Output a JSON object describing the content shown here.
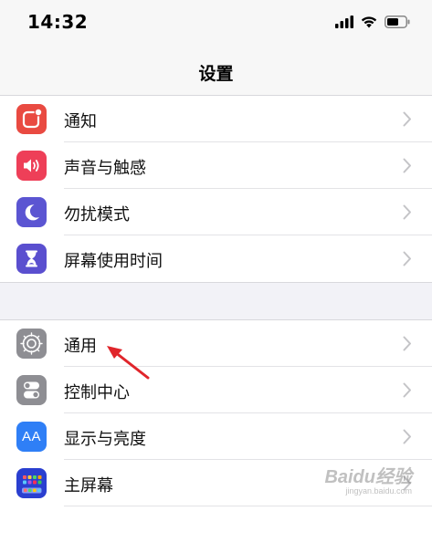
{
  "status_bar": {
    "time": "14:32",
    "icons": [
      "signal-icon",
      "wifi-icon",
      "battery-icon"
    ]
  },
  "nav": {
    "title": "设置"
  },
  "groups": [
    {
      "items": [
        {
          "label": "通知",
          "icon": "notifications-icon",
          "icon_color": "#e94a41"
        },
        {
          "label": "声音与触感",
          "icon": "sound-icon",
          "icon_color": "#ee3f58"
        },
        {
          "label": "勿扰模式",
          "icon": "moon-icon",
          "icon_color": "#5b55d2"
        },
        {
          "label": "屏幕使用时间",
          "icon": "hourglass-icon",
          "icon_color": "#5a4fcf"
        }
      ]
    },
    {
      "items": [
        {
          "label": "通用",
          "icon": "gear-icon",
          "icon_color": "#8e8e93"
        },
        {
          "label": "控制中心",
          "icon": "toggles-icon",
          "icon_color": "#8e8e93"
        },
        {
          "label": "显示与亮度",
          "icon": "display-icon",
          "icon_color": "#2f7ff6",
          "icon_text": "AA"
        },
        {
          "label": "主屏幕",
          "icon": "home-screen-icon",
          "icon_color": "#2a3fd0"
        }
      ]
    }
  ],
  "annotation": {
    "arrow_color": "#e0252b",
    "points_to": "通用"
  },
  "watermark": {
    "text": "Baidu经验",
    "sub": "jingyan.baidu.com"
  },
  "colors": {
    "background": "#f2f2f7",
    "chevron": "#c4c4c7"
  }
}
